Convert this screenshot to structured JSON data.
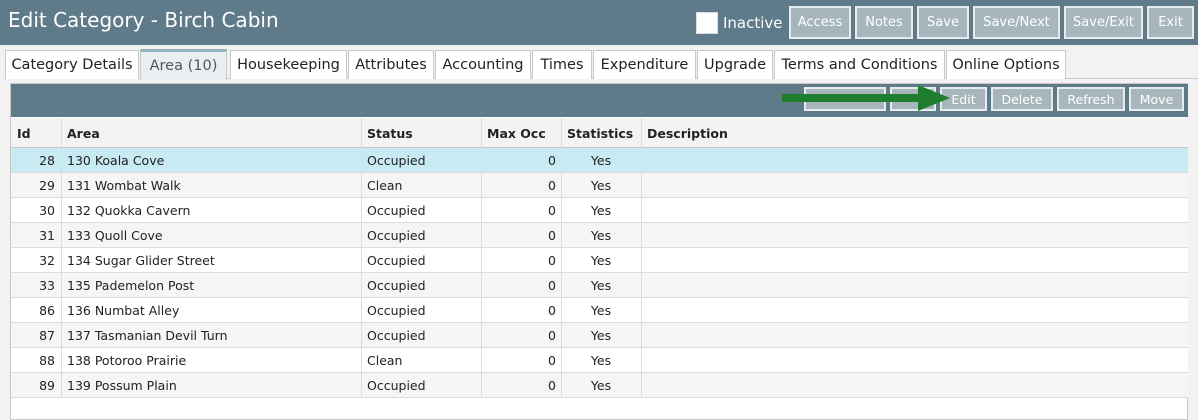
{
  "header": {
    "title": "Edit Category - Birch Cabin",
    "inactive_label": "Inactive",
    "buttons": [
      "Access",
      "Notes",
      "Save",
      "Save/Next",
      "Save/Exit",
      "Exit"
    ]
  },
  "tabs": [
    {
      "label": "Category Details",
      "active": false
    },
    {
      "label": "Area (10)",
      "active": true
    },
    {
      "label": "Housekeeping",
      "active": false
    },
    {
      "label": "Attributes",
      "active": false
    },
    {
      "label": "Accounting",
      "active": false
    },
    {
      "label": "Times",
      "active": false
    },
    {
      "label": "Expenditure",
      "active": false
    },
    {
      "label": "Upgrade",
      "active": false
    },
    {
      "label": "Terms and Conditions",
      "active": false
    },
    {
      "label": "Online Options",
      "active": false
    }
  ],
  "toolbar": {
    "buttons": [
      "Edit",
      "Delete",
      "Refresh",
      "Move"
    ],
    "annotation": "green-arrow-icon"
  },
  "table": {
    "columns": [
      "Id",
      "Area",
      "Status",
      "Max Occ",
      "Statistics",
      "Description"
    ],
    "rows": [
      [
        "28",
        "130 Koala Cove",
        "Occupied",
        "0",
        "Yes",
        ""
      ],
      [
        "29",
        "131 Wombat Walk",
        "Clean",
        "0",
        "Yes",
        ""
      ],
      [
        "30",
        "132 Quokka Cavern",
        "Occupied",
        "0",
        "Yes",
        ""
      ],
      [
        "31",
        "133 Quoll Cove",
        "Occupied",
        "0",
        "Yes",
        ""
      ],
      [
        "32",
        "134 Sugar Glider Street",
        "Occupied",
        "0",
        "Yes",
        ""
      ],
      [
        "33",
        "135 Pademelon Post",
        "Occupied",
        "0",
        "Yes",
        ""
      ],
      [
        "86",
        "136 Numbat Alley",
        "Occupied",
        "0",
        "Yes",
        ""
      ],
      [
        "87",
        "137 Tasmanian Devil Turn",
        "Occupied",
        "0",
        "Yes",
        ""
      ],
      [
        "88",
        "138 Potoroo Prairie",
        "Clean",
        "0",
        "Yes",
        ""
      ],
      [
        "89",
        "139 Possum Plain",
        "Occupied",
        "0",
        "Yes",
        ""
      ]
    ],
    "selected_row": 0
  },
  "colors": {
    "header": "#5f7a88",
    "button": "#a7b5bc",
    "selected_row": "#c7eaf3",
    "arrow": "#1e7e2e"
  }
}
